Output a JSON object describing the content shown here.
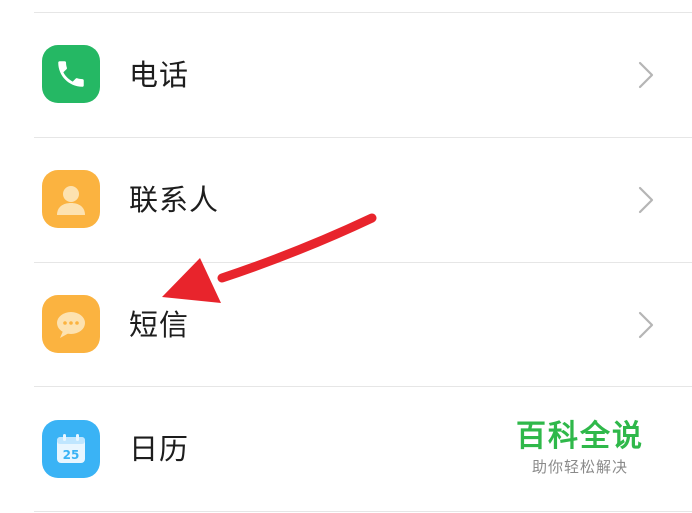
{
  "settings_list": {
    "items": [
      {
        "label": "电话",
        "icon": "phone-icon",
        "icon_color": "#25b864"
      },
      {
        "label": "联系人",
        "icon": "contact-person-icon",
        "icon_color": "#fbb340"
      },
      {
        "label": "短信",
        "icon": "message-bubble-icon",
        "icon_color": "#fbb340"
      },
      {
        "label": "日历",
        "icon": "calendar-icon",
        "icon_color": "#3ab3f5",
        "calendar_day": "25"
      }
    ]
  },
  "annotation": {
    "arrow_color": "#e8242c",
    "points_to": "短信"
  },
  "watermark": {
    "title": "百科全说",
    "subtitle": "助你轻松解决",
    "title_color": "#2fb84a"
  }
}
